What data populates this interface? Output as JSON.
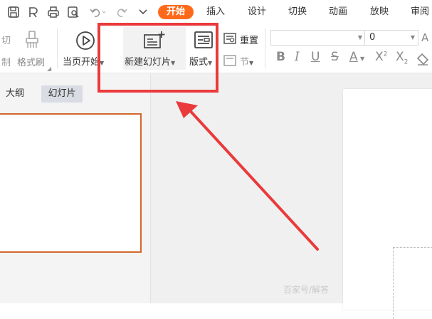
{
  "tabs": [
    "开始",
    "插入",
    "设计",
    "切换",
    "动画",
    "放映",
    "审阅"
  ],
  "ribbon": {
    "cut_label": "切",
    "paste_label": "制",
    "format_painter_label": "格式刷",
    "play_from_current_label": "当页开始",
    "new_slide_label": "新建幻灯片",
    "layout_label": "版式",
    "reset_label": "重置",
    "section_label": "节",
    "font_name_value": "",
    "font_size_value": "0"
  },
  "left_panel": {
    "tab_outline": "大纲",
    "tab_slides": "幻灯片"
  },
  "watermark": "百家号/解答",
  "colors": {
    "accent": "#ff6a1a",
    "highlight_box": "#ea3a3c",
    "thumbnail_border": "#d3672c"
  }
}
